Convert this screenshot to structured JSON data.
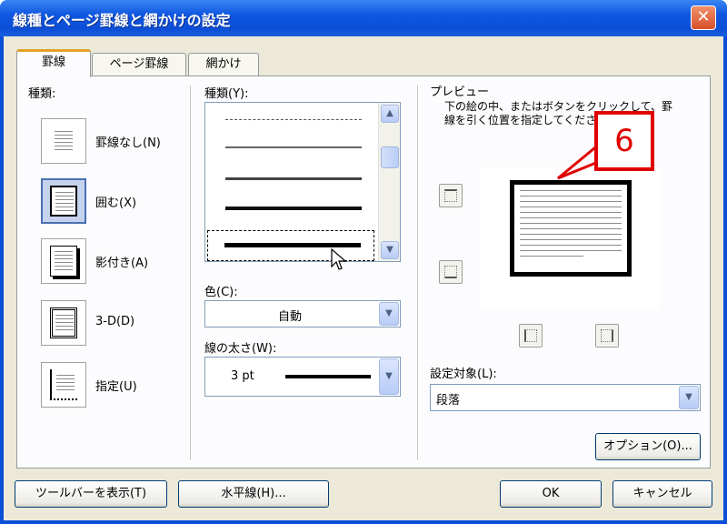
{
  "window": {
    "title": "線種とページ罫線と網かけの設定",
    "close_glyph": "✕"
  },
  "tabs": [
    {
      "label": "罫線"
    },
    {
      "label": "ページ罫線"
    },
    {
      "label": "網かけ"
    }
  ],
  "settings": {
    "heading": "種類:",
    "items": [
      {
        "label": "罫線なし(N)",
        "selected": false
      },
      {
        "label": "囲む(X)",
        "selected": true
      },
      {
        "label": "影付き(A)",
        "selected": false
      },
      {
        "label": "3-D(D)",
        "selected": false
      },
      {
        "label": "指定(U)",
        "selected": false
      }
    ]
  },
  "style": {
    "heading": "種類(Y):",
    "options": [
      "dotted",
      "thin",
      "medium",
      "thick",
      "thick-selected"
    ],
    "scroll_up": "▲",
    "scroll_down": "▼"
  },
  "color": {
    "label": "色(C):",
    "value": "自動"
  },
  "width": {
    "label": "線の太さ(W):",
    "value": "3 pt"
  },
  "preview": {
    "heading": "プレビュー",
    "instructions": "下の絵の中、またはボタンをクリックして、罫線を引く位置を指定してください。"
  },
  "apply_to": {
    "label": "設定対象(L):",
    "value": "段落"
  },
  "buttons": {
    "options": "オプション(O)...",
    "show_toolbar": "ツールバーを表示(T)",
    "horizontal_line": "水平線(H)...",
    "ok": "OK",
    "cancel": "キャンセル"
  },
  "annotation": {
    "step": "6",
    "color": "#e00000"
  },
  "colors": {
    "title_bar": "#0c4fd6",
    "face": "#ece9d8",
    "tab_accent": "#e5a02a"
  },
  "icons": [
    "close-icon",
    "dropdown-arrow-icon",
    "mouse-pointer-icon",
    "border-top-icon",
    "border-bottom-icon",
    "border-left-icon",
    "border-right-icon"
  ]
}
